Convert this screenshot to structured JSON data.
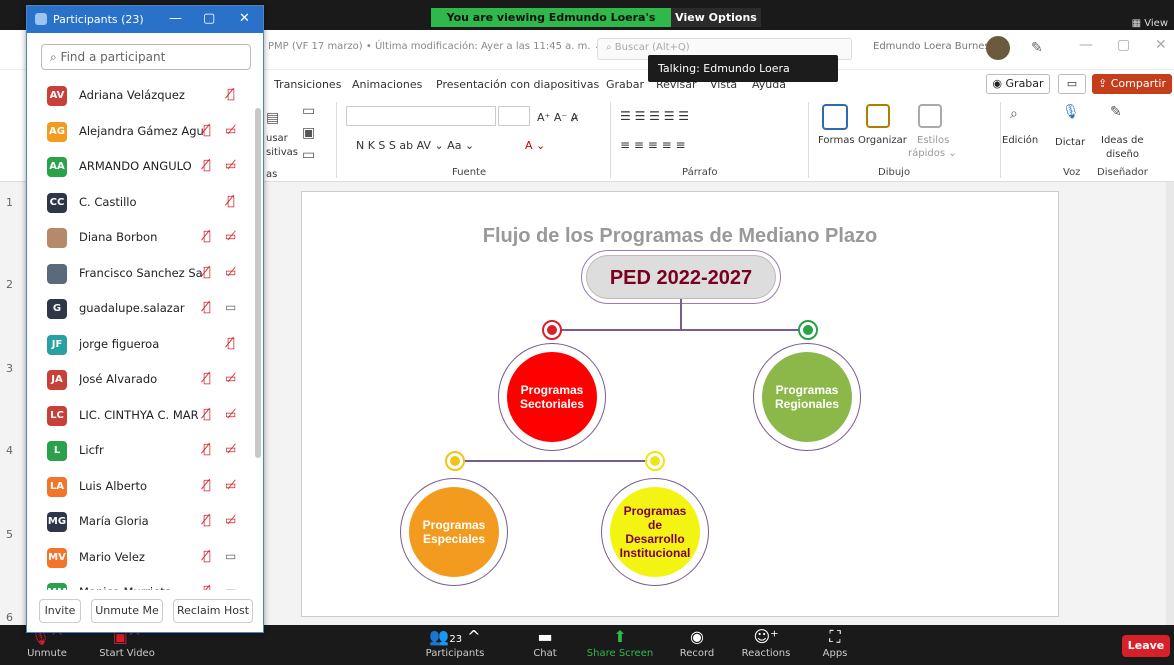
{
  "share_bar": {
    "viewing_text": "You are viewing Edmundo Loera's screen",
    "view_options_label": "View Options ⌄",
    "view_label": "View"
  },
  "ppt": {
    "file_info": "PMP (VF 17 marzo) • Última modificación: Ayer a las 11:45 a. m. ⌄",
    "search_placeholder": "Buscar (Alt+Q)",
    "user_name": "Edmundo Loera Burnes",
    "talking_tooltip": "Talking: Edmundo Loera",
    "menu": [
      "Transiciones",
      "Animaciones",
      "Presentación con diapositivas",
      "Grabar",
      "Revisar",
      "Vista",
      "Ayuda"
    ],
    "grabar_label": "◉ Grabar",
    "comment_icon": "▭",
    "share_label": "⇪ Compartir",
    "ribbon": {
      "groups": [
        "Fuente",
        "Párrafo",
        "Dibujo",
        "Voz",
        "Diseñador"
      ],
      "left_texts": [
        "usar",
        "sitivas",
        "as"
      ],
      "font_buttons": "N  K  S  S  ab  AV ⌄  Aa ⌄",
      "formas": "Formas",
      "organizar": "Organizar",
      "estilos": "Estilos",
      "rapidos": "rápidos ⌄",
      "edicion": "Edición",
      "dictar": "Dictar",
      "ideas_1": "Ideas de",
      "ideas_2": "diseño"
    },
    "slide_numbers": [
      "1",
      "2",
      "3",
      "4",
      "5",
      "6"
    ],
    "slide": {
      "title": "Flujo de los Programas de Mediano Plazo",
      "root": "PED 2022-2027",
      "nodes": [
        {
          "label": [
            "Programas",
            "Sectoriales"
          ],
          "color": "#ff0000",
          "dot": "#d6202a"
        },
        {
          "label": [
            "Programas",
            "Regionales"
          ],
          "color": "#8bb848",
          "dot": "#2aa14a"
        },
        {
          "label": [
            "Programas",
            "Especiales"
          ],
          "color": "#f29b1f",
          "dot": "#f0c419"
        },
        {
          "label": [
            "Programas",
            "de",
            "Desarrollo",
            "Institucional"
          ],
          "color": "#f4f412",
          "dot": "#f0e419"
        }
      ]
    }
  },
  "participants_panel": {
    "title": "Participants (23)",
    "search_placeholder": "Find a participant",
    "participants": [
      {
        "initials": "AV",
        "name": "Adriana Velázquez",
        "bg": "#c8403a",
        "mic": "muted",
        "cam": "none"
      },
      {
        "initials": "AG",
        "name": "Alejandra Gámez Aguirre",
        "bg": "#f29b1f",
        "mic": "muted",
        "cam": "off"
      },
      {
        "initials": "AA",
        "name": "ARMANDO ANGULO",
        "bg": "#2aa14a",
        "mic": "muted",
        "cam": "off"
      },
      {
        "initials": "CC",
        "name": "C. Castillo",
        "bg": "#2d3748",
        "mic": "muted",
        "cam": "none"
      },
      {
        "initials": "",
        "name": "Diana Borbon",
        "bg": "#b58a6a",
        "mic": "muted",
        "cam": "off"
      },
      {
        "initials": "",
        "name": "Francisco Sanchez Sanc...",
        "bg": "#5a6a7a",
        "mic": "muted",
        "cam": "off"
      },
      {
        "initials": "G",
        "name": "guadalupe.salazar",
        "bg": "#2d3748",
        "mic": "muted",
        "cam": "on"
      },
      {
        "initials": "JF",
        "name": "jorge figueroa",
        "bg": "#2aa1a1",
        "mic": "muted",
        "cam": "none"
      },
      {
        "initials": "JA",
        "name": "José Alvarado",
        "bg": "#c8403a",
        "mic": "muted",
        "cam": "off"
      },
      {
        "initials": "LC",
        "name": "LIC. CINTHYA C. MAR",
        "bg": "#c8403a",
        "mic": "muted",
        "cam": "off"
      },
      {
        "initials": "L",
        "name": "Licfr",
        "bg": "#2aa14a",
        "mic": "muted",
        "cam": "off"
      },
      {
        "initials": "LA",
        "name": "Luis Alberto",
        "bg": "#f2762a",
        "mic": "muted",
        "cam": "off"
      },
      {
        "initials": "MG",
        "name": "María Gloria",
        "bg": "#2d3748",
        "mic": "muted",
        "cam": "off"
      },
      {
        "initials": "MV",
        "name": "Mario Velez",
        "bg": "#f2762a",
        "mic": "muted",
        "cam": "on"
      },
      {
        "initials": "MM",
        "name": "Monica Murrieta",
        "bg": "#2aa14a",
        "mic": "muted",
        "cam": "on"
      }
    ],
    "footer": {
      "invite": "Invite",
      "unmute_me": "Unmute Me",
      "reclaim_host": "Reclaim Host"
    }
  },
  "bottom_bar": {
    "unmute": "Unmute",
    "start_video": "Start Video",
    "participants": "Participants",
    "participants_count": "23",
    "chat": "Chat",
    "share_screen": "Share Screen",
    "record": "Record",
    "reactions": "Reactions",
    "apps": "Apps",
    "leave": "Leave"
  }
}
